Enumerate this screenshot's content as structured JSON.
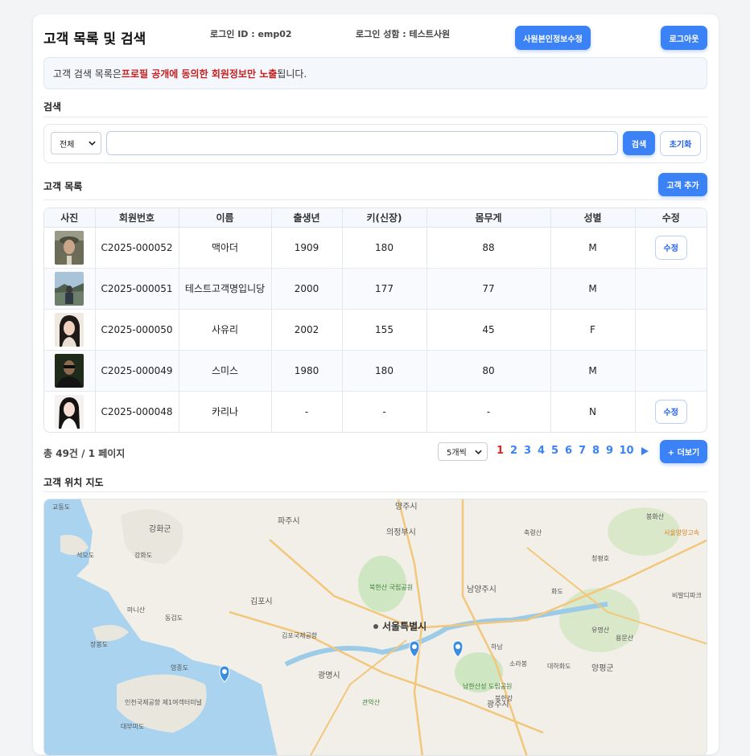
{
  "header": {
    "title": "고객 목록 및 검색",
    "login_id": "로그인 ID : emp02",
    "login_name": "로그인 성함 : 테스트사원",
    "edit_profile_button": "사원본인정보수정",
    "logout_button": "로그아웃"
  },
  "notice": {
    "prefix": "고객 검색 목록은 ",
    "highlight": "프로필 공개에 동의한 회원정보만 노출",
    "suffix": "됩니다."
  },
  "search": {
    "section_title": "검색",
    "scope_selected": "전체",
    "query_value": "",
    "query_placeholder": "",
    "search_button": "검색",
    "reset_button": "초기화"
  },
  "list": {
    "section_title": "고객 목록",
    "add_button": "고객 추가",
    "columns": [
      "사진",
      "회원번호",
      "이름",
      "출생년",
      "키(신장)",
      "몸무게",
      "성별",
      "수정"
    ],
    "rows": [
      {
        "id": "C2025-000052",
        "name": "맥아더",
        "birth": "1909",
        "height": "180",
        "weight": "88",
        "gender": "M",
        "edit": "수정"
      },
      {
        "id": "C2025-000051",
        "name": "테스트고객명입니당",
        "birth": "2000",
        "height": "177",
        "weight": "77",
        "gender": "M",
        "edit": ""
      },
      {
        "id": "C2025-000050",
        "name": "사유리",
        "birth": "2002",
        "height": "155",
        "weight": "45",
        "gender": "F",
        "edit": ""
      },
      {
        "id": "C2025-000049",
        "name": "스미스",
        "birth": "1980",
        "height": "180",
        "weight": "80",
        "gender": "M",
        "edit": ""
      },
      {
        "id": "C2025-000048",
        "name": "카리나",
        "birth": "-",
        "height": "-",
        "weight": "-",
        "gender": "N",
        "edit": "수정"
      }
    ]
  },
  "pagination": {
    "summary": "총 49건 / 1 페이지",
    "page_size": "5개씩",
    "pages": [
      "1",
      "2",
      "3",
      "4",
      "5",
      "6",
      "7",
      "8",
      "9",
      "10"
    ],
    "current_page": "1",
    "next_icon": "next-triangle-icon",
    "more_button": "+ 더보기"
  },
  "map": {
    "section_title": "고객 위치 지도",
    "labels": {
      "seoul": "서울특별시",
      "gimpo": "김포시",
      "gwangmyeong": "광명시",
      "gwangju": "광주시",
      "namyangju": "남양주시",
      "uijeongbu": "의정부시",
      "yangju": "양주시",
      "paju": "파주시",
      "ganghwa": "강화군",
      "yangpyeong": "양평군",
      "gyodong": "교동도",
      "seongmo": "석모도",
      "ganghwado": "강화도",
      "manisan": "마니산",
      "donggeomdo": "동검도",
      "janbongdo": "장봉도",
      "yeongjongdo": "영종도",
      "bukhansan": "북한산 국립공원",
      "namhansanseong": "남한산성 도립공원",
      "gwanaksan": "관악산",
      "bukhangang": "북한강",
      "sora": "소라봉",
      "hanam": "하남",
      "airport_gimpo": "김포국제공항",
      "airport_incheon": "인천국제공항 제1여객터미널",
      "yumyeongsan": "유명산",
      "yongmunsan": "용문산",
      "daehwado": "대하화도",
      "chukryeongsan": "축령산",
      "bonghwasan": "봉화산",
      "cheongpyeong": "청평호",
      "hwado": "화도",
      "bibalmi": "비발디파크",
      "sidelabel": "서울양양고속",
      "daebudo": "대부미도"
    }
  },
  "colors": {
    "accent": "#3b82f6",
    "highlight_red": "#c81e1e",
    "active_page": "#dc2626"
  }
}
